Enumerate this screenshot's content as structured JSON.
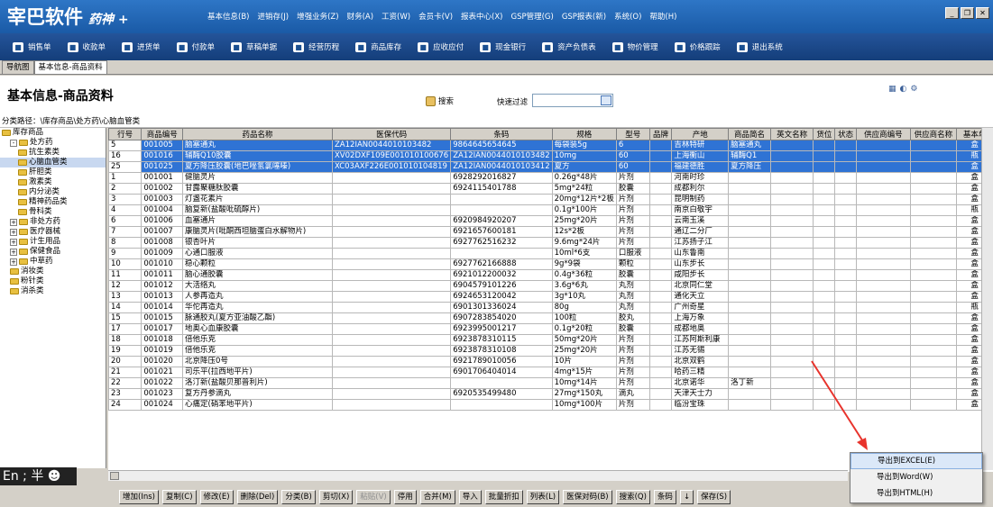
{
  "app": {
    "logo": "宰巴软件",
    "logo_sub": "药神 +"
  },
  "menu": [
    "基本信息(B)",
    "进销存(J)",
    "增强业务(Z)",
    "财务(A)",
    "工资(W)",
    "会员卡(V)",
    "报表中心(X)",
    "GSP管理(G)",
    "GSP报表(新)",
    "系统(O)",
    "帮助(H)"
  ],
  "toolbar": [
    "销售单",
    "收款单",
    "进货单",
    "付款单",
    "草稿单据",
    "经营历程",
    "商品库存",
    "应收应付",
    "现金银行",
    "资产负债表",
    "物价管理",
    "价格跟踪",
    "退出系统"
  ],
  "tabs": [
    "导航图",
    "基本信息-商品资料"
  ],
  "header": {
    "title": "基本信息-商品资料",
    "search_label": "搜索",
    "quick_filter_label": "快速过滤",
    "quick_filter_value": ""
  },
  "path": "分类路径：\\库存商品\\处方药\\心脑血管类",
  "tree": [
    {
      "label": "库存商品",
      "level": 0,
      "pm": ""
    },
    {
      "label": "处方药",
      "level": 1,
      "pm": "-"
    },
    {
      "label": "抗生素类",
      "level": 2,
      "pm": ""
    },
    {
      "label": "心脑血管类",
      "level": 2,
      "pm": "",
      "selected": true
    },
    {
      "label": "肝胆类",
      "level": 2,
      "pm": ""
    },
    {
      "label": "激素类",
      "level": 2,
      "pm": ""
    },
    {
      "label": "内分泌类",
      "level": 2,
      "pm": ""
    },
    {
      "label": "精神药品类",
      "level": 2,
      "pm": ""
    },
    {
      "label": "骨科类",
      "level": 2,
      "pm": ""
    },
    {
      "label": "非处方药",
      "level": 1,
      "pm": "+"
    },
    {
      "label": "医疗器械",
      "level": 1,
      "pm": "+"
    },
    {
      "label": "计生用品",
      "level": 1,
      "pm": "+"
    },
    {
      "label": "保健食品",
      "level": 1,
      "pm": "+"
    },
    {
      "label": "中草药",
      "level": 1,
      "pm": "+"
    },
    {
      "label": "消妆类",
      "level": 1,
      "pm": ""
    },
    {
      "label": "粉针类",
      "level": 1,
      "pm": ""
    },
    {
      "label": "消杀类",
      "level": 1,
      "pm": ""
    }
  ],
  "ime": "En ; 半 ☻",
  "columns": [
    "行号",
    "商品编号",
    "药品名称",
    "医保代码",
    "条码",
    "规格",
    "型号",
    "品牌",
    "产地",
    "商品简名",
    "英文名称",
    "货位",
    "状态",
    "供应商编号",
    "供应商名称",
    "基本单"
  ],
  "rows": [
    [
      "5",
      "001005",
      "脑塞通丸",
      "ZA12IAN0044010103482",
      "9864645654645",
      "每袋装5g",
      "6",
      "",
      "吉林特研",
      "脑塞通丸",
      "",
      "",
      "",
      "",
      "",
      "盒"
    ],
    [
      "16",
      "001016",
      "辅酶Q10胶囊",
      "XV02DXF109E001010100676",
      "ZA12IAN0044010103482",
      "10mg",
      "60",
      "",
      "上海衡山",
      "辅酶Q1",
      "",
      "",
      "",
      "",
      "",
      "瓶"
    ],
    [
      "25",
      "001025",
      "夏方降压胶囊(地巴唑氢氯噻嗪)",
      "XC03AXF226E001010104819",
      "ZA12IAN0044010103412",
      "夏方",
      "60",
      "",
      "福建德胜",
      "夏方降压",
      "",
      "",
      "",
      "",
      "",
      "盒"
    ],
    [
      "1",
      "001001",
      "健脑灵片",
      "",
      "6928292016827",
      "0.26g*48片",
      "片剂",
      "",
      "河南时珍",
      "",
      "",
      "",
      "",
      "",
      "",
      "盒"
    ],
    [
      "2",
      "001002",
      "甘露聚糖肽胶囊",
      "",
      "6924115401788",
      "5mg*24粒",
      "胶囊",
      "",
      "成都利尔",
      "",
      "",
      "",
      "",
      "",
      "",
      "盒"
    ],
    [
      "3",
      "001003",
      "灯盏花素片",
      "",
      "",
      "20mg*12片*2板",
      "片剂",
      "",
      "昆明制药",
      "",
      "",
      "",
      "",
      "",
      "",
      "盒"
    ],
    [
      "4",
      "001004",
      "脑复新(盐酸吡硫醇片)",
      "",
      "",
      "0.1g*100片",
      "片剂",
      "",
      "南京白敬宇",
      "",
      "",
      "",
      "",
      "",
      "",
      "瓶"
    ],
    [
      "6",
      "001006",
      "血塞通片",
      "",
      "6920984920207",
      "25mg*20片",
      "片剂",
      "",
      "云南玉溪",
      "",
      "",
      "",
      "",
      "",
      "",
      "盒"
    ],
    [
      "7",
      "001007",
      "康脑灵片(吡酮西坦脑蛋白水解物片)",
      "",
      "6921657600181",
      "12s*2板",
      "片剂",
      "",
      "通辽二分厂",
      "",
      "",
      "",
      "",
      "",
      "",
      "盒"
    ],
    [
      "8",
      "001008",
      "银杏叶片",
      "",
      "6927762516232",
      "9.6mg*24片",
      "片剂",
      "",
      "江苏扬子江",
      "",
      "",
      "",
      "",
      "",
      "",
      "盒"
    ],
    [
      "9",
      "001009",
      "心通口服液",
      "",
      "",
      "10ml*6支",
      "口服液",
      "",
      "山东鲁南",
      "",
      "",
      "",
      "",
      "",
      "",
      "盒"
    ],
    [
      "10",
      "001010",
      "稳心颗粒",
      "",
      "6927762166888",
      "9g*9袋",
      "颗粒",
      "",
      "山东步长",
      "",
      "",
      "",
      "",
      "",
      "",
      "盒"
    ],
    [
      "11",
      "001011",
      "脑心通胶囊",
      "",
      "6921012200032",
      "0.4g*36粒",
      "胶囊",
      "",
      "咸阳步长",
      "",
      "",
      "",
      "",
      "",
      "",
      "盒"
    ],
    [
      "12",
      "001012",
      "大活络丸",
      "",
      "6904579101226",
      "3.6g*6丸",
      "丸剂",
      "",
      "北京同仁堂",
      "",
      "",
      "",
      "",
      "",
      "",
      "盒"
    ],
    [
      "13",
      "001013",
      "人参再造丸",
      "",
      "6924653120042",
      "3g*10丸",
      "丸剂",
      "",
      "通化天立",
      "",
      "",
      "",
      "",
      "",
      "",
      "盒"
    ],
    [
      "14",
      "001014",
      "华佗再造丸",
      "",
      "6901301336024",
      "80g",
      "丸剂",
      "",
      "广州奇星",
      "",
      "",
      "",
      "",
      "",
      "",
      "瓶"
    ],
    [
      "15",
      "001015",
      "脉通胶丸(夏方亚油酸乙酯)",
      "",
      "6907283854020",
      "100粒",
      "胶丸",
      "",
      "上海万象",
      "",
      "",
      "",
      "",
      "",
      "",
      "盒"
    ],
    [
      "17",
      "001017",
      "地奥心血康胶囊",
      "",
      "6923995001217",
      "0.1g*20粒",
      "胶囊",
      "",
      "成都地奥",
      "",
      "",
      "",
      "",
      "",
      "",
      "盒"
    ],
    [
      "18",
      "001018",
      "倍他乐克",
      "",
      "6923878310115",
      "50mg*20片",
      "片剂",
      "",
      "江苏阿斯利康",
      "",
      "",
      "",
      "",
      "",
      "",
      "盒"
    ],
    [
      "19",
      "001019",
      "倍他乐克",
      "",
      "6923878310108",
      "25mg*20片",
      "片剂",
      "",
      "江苏无锡",
      "",
      "",
      "",
      "",
      "",
      "",
      "盒"
    ],
    [
      "20",
      "001020",
      "北京降压0号",
      "",
      "6921789010056",
      "10片",
      "片剂",
      "",
      "北京双鹤",
      "",
      "",
      "",
      "",
      "",
      "",
      "盒"
    ],
    [
      "21",
      "001021",
      "司乐平(拉西地平片)",
      "",
      "6901706404014",
      "4mg*15片",
      "片剂",
      "",
      "哈药三精",
      "",
      "",
      "",
      "",
      "",
      "",
      "盒"
    ],
    [
      "22",
      "001022",
      "洛汀新(盐酸贝那普利片)",
      "",
      "",
      "10mg*14片",
      "片剂",
      "",
      "北京诺华",
      "洛丁新",
      "",
      "",
      "",
      "",
      "",
      "盒"
    ],
    [
      "23",
      "001023",
      "复方丹参滴丸",
      "",
      "6920535499480",
      "27mg*150丸",
      "滴丸",
      "",
      "天津天士力",
      "",
      "",
      "",
      "",
      "",
      "",
      "盒"
    ],
    [
      "24",
      "001024",
      "心痛定(硝苯地平片)",
      "",
      "",
      "10mg*100片",
      "片剂",
      "",
      "临汾宝珠",
      "",
      "",
      "",
      "",
      "",
      "",
      "盒"
    ]
  ],
  "buttons": [
    {
      "label": "增加(Ins)"
    },
    {
      "label": "复制(C)"
    },
    {
      "label": "修改(E)"
    },
    {
      "label": "删除(Del)"
    },
    {
      "label": "分类(B)"
    },
    {
      "label": "剪切(X)"
    },
    {
      "label": "粘贴(V)",
      "disabled": true
    },
    {
      "label": "停用"
    },
    {
      "label": "合并(M)"
    },
    {
      "label": "导入"
    },
    {
      "label": "批量折扣"
    },
    {
      "label": "列表(L)"
    },
    {
      "label": "医保对码(B)"
    },
    {
      "label": "搜索(Q)"
    },
    {
      "label": "条码"
    },
    {
      "label": "↓"
    },
    {
      "label": "保存(S)"
    }
  ],
  "context_menu": [
    "导出到EXCEL(E)",
    "导出到Word(W)",
    "导出到HTML(H)"
  ],
  "colors": {
    "titlebar": "#2e76c6",
    "selection": "#2f73d4",
    "annotation_arrow": "#e8332c"
  }
}
